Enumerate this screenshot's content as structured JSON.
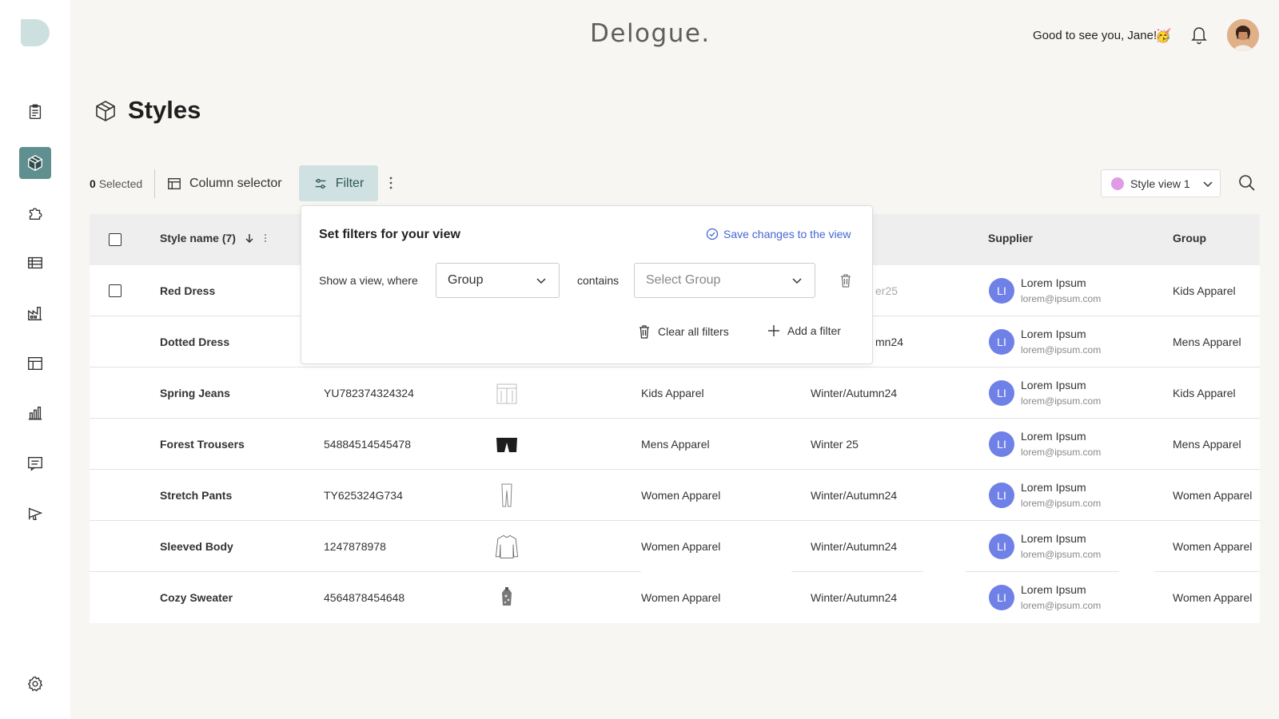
{
  "brand": "Delogue.",
  "greeting": "Good to see you, Jane!",
  "greeting_emoji": "🥳",
  "page": {
    "title": "Styles"
  },
  "toolbar": {
    "selected_count": "0",
    "selected_label": "Selected",
    "column_selector_label": "Column selector",
    "filter_label": "Filter",
    "view_select_label": "Style view 1",
    "view_dot_color": "#e19be6"
  },
  "table": {
    "headers": {
      "style_name": "Style name (7)",
      "supplier": "Supplier",
      "group": "Group"
    },
    "rows": [
      {
        "name": "Red Dress",
        "number": "",
        "thumb": "dress-icon",
        "group_col": "",
        "season": "er25",
        "supplier_initials": "LI",
        "supplier_name": "Lorem Ipsum",
        "supplier_email": "lorem@ipsum.com",
        "group": "Kids Apparel"
      },
      {
        "name": "Dotted Dress",
        "number": "",
        "thumb": "dress-icon",
        "group_col": "",
        "season": "mn24",
        "supplier_initials": "LI",
        "supplier_name": "Lorem Ipsum",
        "supplier_email": "lorem@ipsum.com",
        "group": "Mens Apparel"
      },
      {
        "name": "Spring Jeans",
        "number": "YU782374324324",
        "thumb": "jeans-sketch-icon",
        "group_col": "Kids Apparel",
        "season": "Winter/Autumn24",
        "supplier_initials": "LI",
        "supplier_name": "Lorem Ipsum",
        "supplier_email": "lorem@ipsum.com",
        "group": "Kids Apparel"
      },
      {
        "name": "Forest Trousers",
        "number": "54884514545478",
        "thumb": "trousers-icon",
        "group_col": "Mens Apparel",
        "season": "Winter 25",
        "supplier_initials": "LI",
        "supplier_name": "Lorem Ipsum",
        "supplier_email": "lorem@ipsum.com",
        "group": "Mens Apparel"
      },
      {
        "name": "Stretch Pants",
        "number": "TY625324G734",
        "thumb": "pants-sketch-icon",
        "group_col": "Women Apparel",
        "season": "Winter/Autumn24",
        "supplier_initials": "LI",
        "supplier_name": "Lorem Ipsum",
        "supplier_email": "lorem@ipsum.com",
        "group": "Women Apparel"
      },
      {
        "name": "Sleeved Body",
        "number": "1247878978",
        "thumb": "sweater-sketch-icon",
        "group_col": "Women Apparel",
        "season": "Winter/Autumn24",
        "supplier_initials": "LI",
        "supplier_name": "Lorem Ipsum",
        "supplier_email": "lorem@ipsum.com",
        "group": "Women Apparel"
      },
      {
        "name": "Cozy Sweater",
        "number": "4564878454648",
        "thumb": "sweater-photo-icon",
        "group_col": "Women Apparel",
        "season": "Winter/Autumn24",
        "supplier_initials": "LI",
        "supplier_name": "Lorem Ipsum",
        "supplier_email": "lorem@ipsum.com",
        "group": "Women Apparel"
      }
    ]
  },
  "filter_popover": {
    "title": "Set filters for your view",
    "save_label": "Save changes to the view",
    "where_label": "Show a view, where",
    "field_value": "Group",
    "operator_label": "contains",
    "value_placeholder": "Select Group",
    "clear_label": "Clear all filters",
    "add_label": "Add a filter"
  },
  "colors": {
    "accent": "#5f8f8f",
    "filter_bg": "#cfe1e1",
    "link": "#4466d6",
    "supplier_avatar": "#6f80e6"
  }
}
